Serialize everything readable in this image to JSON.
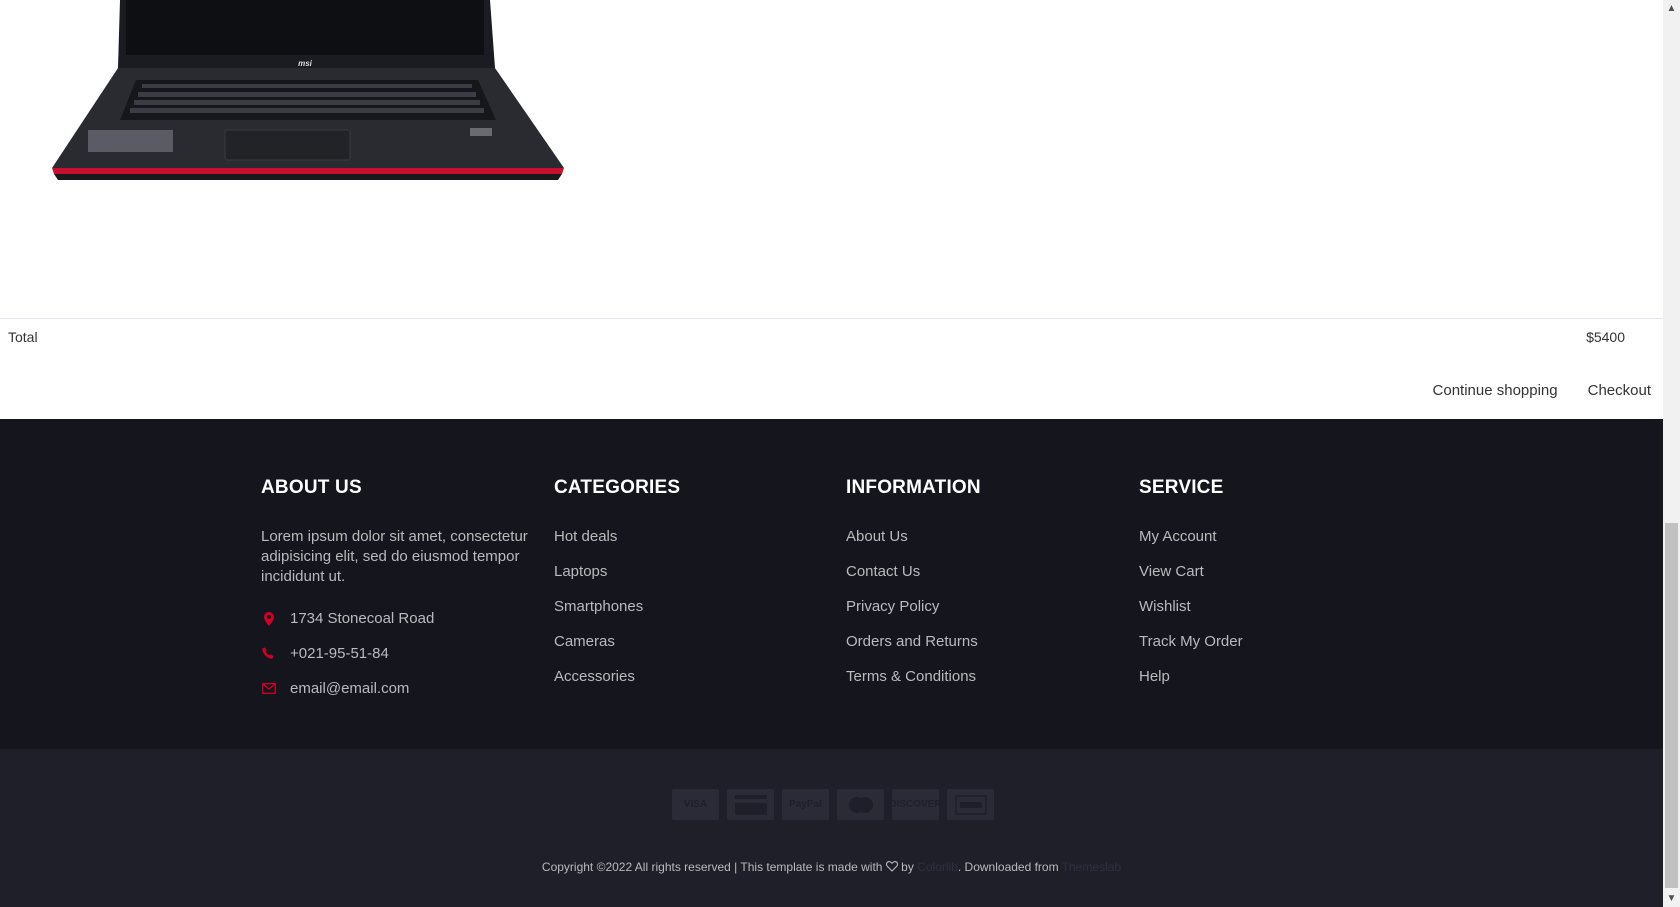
{
  "cart": {
    "total_label": "Total",
    "total_value": "$5400",
    "continue_label": "Continue shopping",
    "checkout_label": "Checkout",
    "product_image": "msi-laptop-image"
  },
  "footer": {
    "about": {
      "title": "About Us",
      "text": "Lorem ipsum dolor sit amet, consectetur adipisicing elit, sed do eiusmod tempor incididunt ut.",
      "address": "1734 Stonecoal Road",
      "phone": "+021-95-51-84",
      "email": "email@email.com"
    },
    "categories": {
      "title": "Categories",
      "items": [
        "Hot deals",
        "Laptops",
        "Smartphones",
        "Cameras",
        "Accessories"
      ]
    },
    "information": {
      "title": "Information",
      "items": [
        "About Us",
        "Contact Us",
        "Privacy Policy",
        "Orders and Returns",
        "Terms & Conditions"
      ]
    },
    "service": {
      "title": "Service",
      "items": [
        "My Account",
        "View Cart",
        "Wishlist",
        "Track My Order",
        "Help"
      ]
    },
    "payments": [
      "VISA",
      "",
      "PayPal",
      "",
      "DISCOVER",
      ""
    ],
    "copyright": {
      "prefix": "Copyright ©2022 All rights reserved | This template is made with",
      "by": "by",
      "colorlib": "Colorlib",
      "downloaded": ". Downloaded from",
      "themeslab": "Themeslab"
    }
  },
  "colors": {
    "accent": "#d10024",
    "footer_bg": "#15161d",
    "footer_bottom_bg": "#1e1f29"
  }
}
